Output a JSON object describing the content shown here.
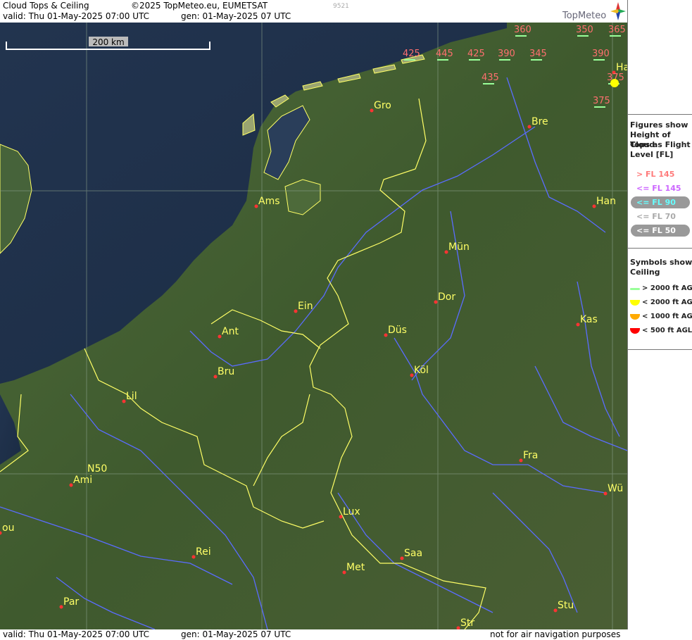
{
  "header": {
    "product": "Cloud Tops & Ceiling",
    "copyright": "©2025 TopMeteo.eu, EUMETSAT",
    "code": "9521",
    "valid": "valid:  Thu  01-May-2025  07:00 UTC",
    "gen": "gen: 01-May-2025 07 UTC",
    "brand": "TopMeteo"
  },
  "footer": {
    "valid": "valid:  Thu  01-May-2025  07:00 UTC",
    "gen": "gen: 01-May-2025 07 UTC",
    "disclaimer": "not for air navigation purposes"
  },
  "scale": {
    "label": "200 km"
  },
  "gridlabel": "N50",
  "cities": [
    {
      "name": "Gro"
    },
    {
      "name": "Bre"
    },
    {
      "name": "Ams"
    },
    {
      "name": "Han"
    },
    {
      "name": "Mün"
    },
    {
      "name": "Dor"
    },
    {
      "name": "Ein"
    },
    {
      "name": "Kas"
    },
    {
      "name": "Ant"
    },
    {
      "name": "Düs"
    },
    {
      "name": "Bru"
    },
    {
      "name": "Köl"
    },
    {
      "name": "Lil"
    },
    {
      "name": "Fra"
    },
    {
      "name": "Ami"
    },
    {
      "name": "Wü"
    },
    {
      "name": "Lux"
    },
    {
      "name": "ou"
    },
    {
      "name": "Rei"
    },
    {
      "name": "Saa"
    },
    {
      "name": "Met"
    },
    {
      "name": "Par"
    },
    {
      "name": "Stu"
    },
    {
      "name": "Str"
    },
    {
      "name": "Ha"
    }
  ],
  "flight_levels": [
    {
      "value": "360"
    },
    {
      "value": "350"
    },
    {
      "value": "365"
    },
    {
      "value": "425"
    },
    {
      "value": "445"
    },
    {
      "value": "425"
    },
    {
      "value": "390"
    },
    {
      "value": "345"
    },
    {
      "value": "390"
    },
    {
      "value": "435"
    },
    {
      "value": "375"
    },
    {
      "value": "375"
    }
  ],
  "legend": {
    "tops_title_lines": [
      "Figures show",
      "Height of Cloud",
      "Tops as Flight",
      "Level  [FL]"
    ],
    "tops_items": [
      {
        "label": "> FL 145",
        "color": "#ff7a7a"
      },
      {
        "label": "<= FL 145",
        "color": "#cc66ff"
      },
      {
        "label": "<= FL 90",
        "color": "#66ffff"
      },
      {
        "label": "<= FL 70",
        "color": "#aaaaaa"
      },
      {
        "label": "<= FL 50",
        "color": "#ffffff"
      }
    ],
    "ceiling_title_lines": [
      "Symbols show",
      "Ceiling"
    ],
    "ceiling_items": [
      {
        "label": "> 2000 ft AGL",
        "color": "#99ff99"
      },
      {
        "label": "< 2000 ft AGL",
        "color": "#ffff00"
      },
      {
        "label": "< 1000 ft AGL",
        "color": "#ffaa00"
      },
      {
        "label": "< 500 ft AGL",
        "color": "#ff0000"
      }
    ]
  }
}
